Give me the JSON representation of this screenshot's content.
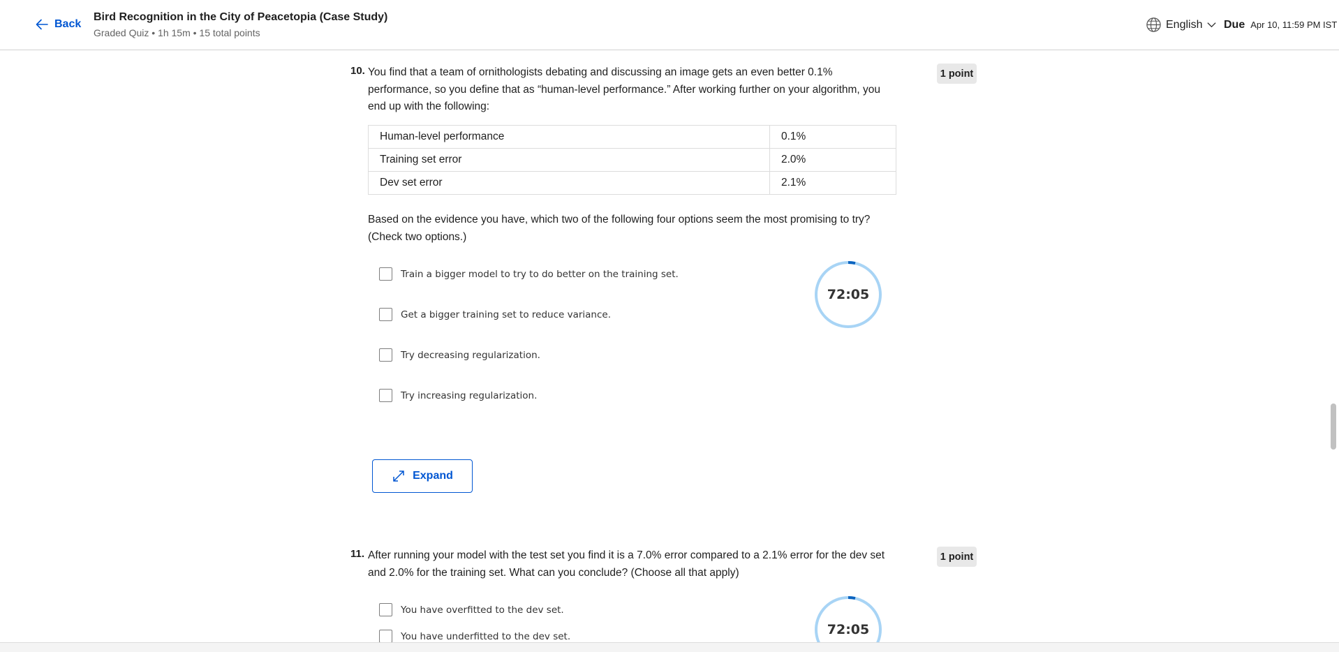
{
  "header": {
    "back_label": "Back",
    "title": "Bird Recognition in the City of Peacetopia (Case Study)",
    "subtitle": "Graded Quiz • 1h 15m • 15 total points",
    "language": "English",
    "due_label": "Due",
    "due_date": "Apr 10, 11:59 PM IST"
  },
  "questions": [
    {
      "number": "10.",
      "points": "1 point",
      "text": "You find that a team of ornithologists debating and discussing an image gets an even better 0.1% performance, so you define that as “human-level performance.” After working further on your algorithm, you end up with the following:",
      "table": [
        [
          "Human-level performance",
          "0.1%"
        ],
        [
          "Training set error",
          "2.0%"
        ],
        [
          "Dev set error",
          "2.1%"
        ]
      ],
      "prompt": "Based on the evidence you have, which two of the following four options seem the most promising to try? (Check two options.)",
      "options": [
        "Train a bigger model to try to do better on the training set.",
        "Get a bigger training set to reduce variance.",
        "Try decreasing regularization.",
        "Try increasing regularization."
      ],
      "timer": "72:05",
      "expand_label": "Expand"
    },
    {
      "number": "11.",
      "points": "1 point",
      "text": "After running your model with the test set you find it is a 7.0% error compared to a 2.1% error for the dev set and 2.0% for the training set. What can you conclude? (Choose all that apply)",
      "options": [
        "You have overfitted to the dev set.",
        "You have underfitted to the dev set."
      ],
      "timer": "72:05"
    }
  ],
  "colors": {
    "accent": "#0056d2",
    "timer_ring": "#a8d4f5",
    "timer_progress": "#0b64c0",
    "points_badge": "#e8e8e8"
  },
  "icons": [
    "arrow-left-icon",
    "globe-icon",
    "chevron-down-icon",
    "expand-arrows-icon"
  ]
}
